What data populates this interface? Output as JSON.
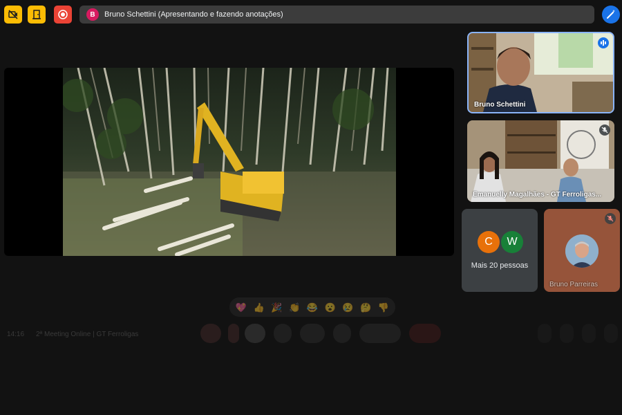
{
  "presenter": {
    "initial": "B",
    "text": "Bruno Schettini (Apresentando e fazendo anotações)"
  },
  "participants": [
    {
      "name": "Bruno Schettini"
    },
    {
      "name": "Emanuelly Magalhães - GT Ferroligas..."
    },
    {
      "name": "Bruno Parreiras"
    }
  ],
  "more": {
    "initials": [
      "C",
      "W"
    ],
    "label": "Mais 20 pessoas"
  },
  "reactions": [
    "💖",
    "👍",
    "🎉",
    "👏",
    "😂",
    "😮",
    "😢",
    "🤔",
    "👎"
  ],
  "bottom": {
    "time": "14:16",
    "meeting": "2ª Meeting Online | GT Ferroligas"
  },
  "colors": {
    "yellow": "#fbbc04",
    "red": "#ea4335",
    "blue": "#1a73e8",
    "orange": "#e8710a",
    "green": "#188038"
  }
}
